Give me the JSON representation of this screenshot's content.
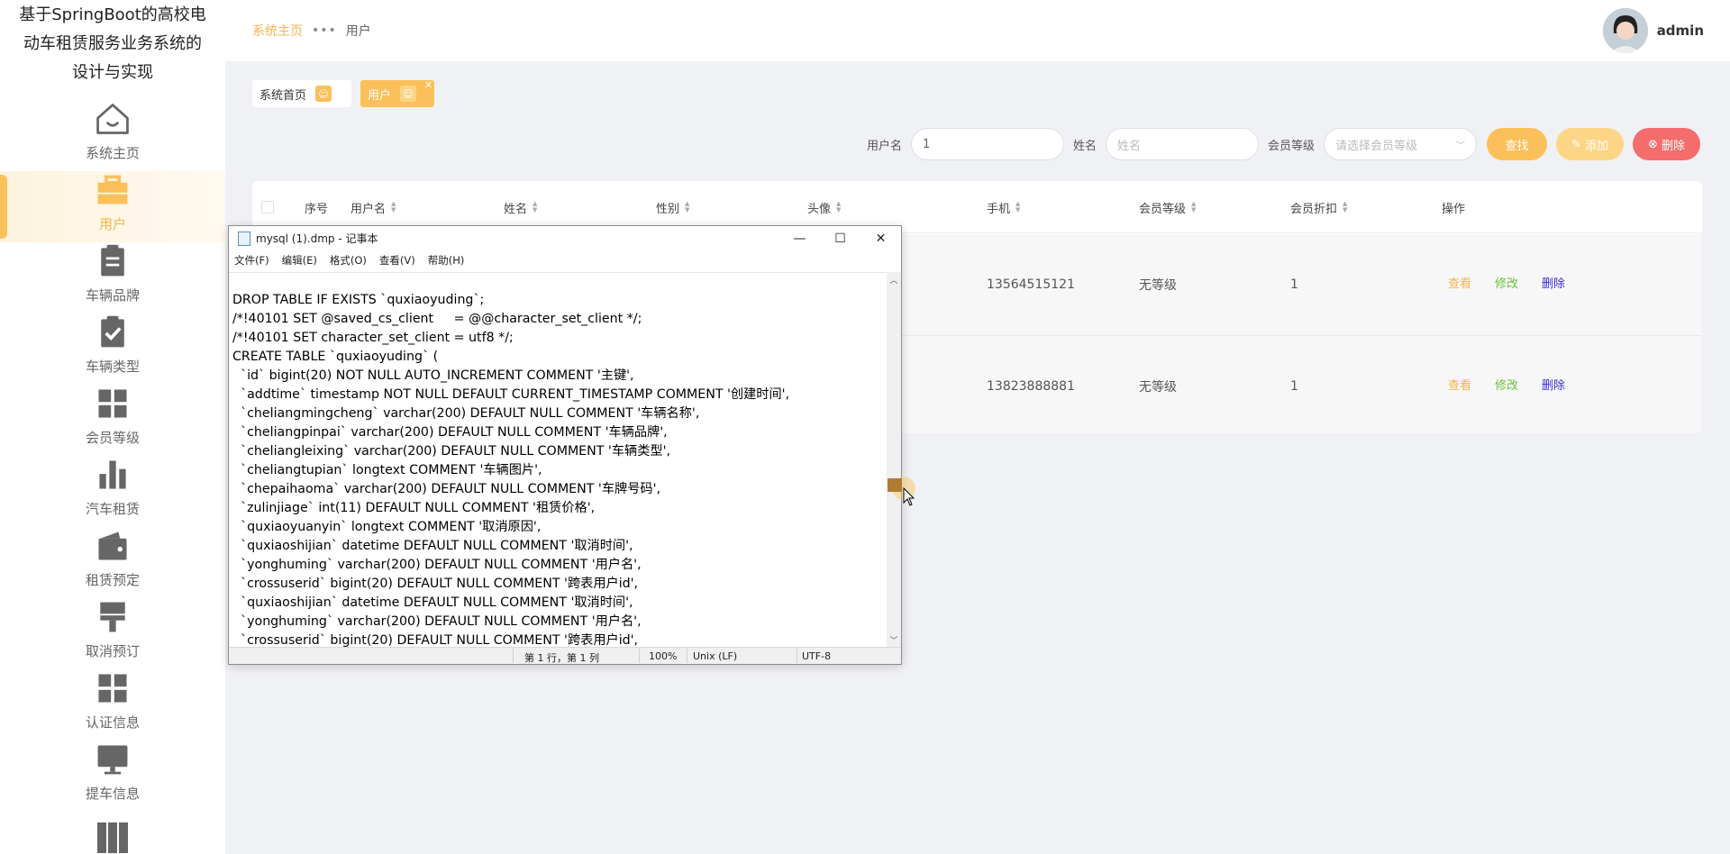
{
  "app": {
    "title_line1": "基于SpringBoot的高校电",
    "title_line2": "动车租赁服务业务系统的",
    "title_line3": "设计与实现"
  },
  "sidebar": {
    "items": [
      {
        "label": "系统主页",
        "icon": "home-icon"
      },
      {
        "label": "用户",
        "icon": "briefcase-icon",
        "active": true
      },
      {
        "label": "车辆品牌",
        "icon": "clipboard-icon"
      },
      {
        "label": "车辆类型",
        "icon": "checklist-icon"
      },
      {
        "label": "会员等级",
        "icon": "grid-icon"
      },
      {
        "label": "汽车租赁",
        "icon": "bar-chart-icon"
      },
      {
        "label": "租赁预定",
        "icon": "wallet-icon"
      },
      {
        "label": "取消预订",
        "icon": "brush-icon"
      },
      {
        "label": "认证信息",
        "icon": "grid-icon"
      },
      {
        "label": "提车信息",
        "icon": "monitor-icon"
      }
    ]
  },
  "header": {
    "breadcrumb_home": "系统主页",
    "breadcrumb_sep": "•••",
    "breadcrumb_current": "用户",
    "username": "admin"
  },
  "tags": {
    "home": "系统首页",
    "current": "用户"
  },
  "search": {
    "username_label": "用户名",
    "username_value": "1",
    "name_label": "姓名",
    "name_placeholder": "姓名",
    "level_label": "会员等级",
    "level_placeholder": "请选择会员等级",
    "find_button": "查找",
    "add_button": "添加",
    "delete_button": "删除"
  },
  "table": {
    "headers": [
      "序号",
      "用户名",
      "姓名",
      "性别",
      "头像",
      "手机",
      "会员等级",
      "会员折扣",
      "操作"
    ],
    "rows": [
      {
        "phone": "13564515121",
        "level": "无等级",
        "discount": "1"
      },
      {
        "phone": "13823888881",
        "level": "无等级",
        "discount": "1"
      }
    ],
    "actions": {
      "view": "查看",
      "edit": "修改",
      "delete": "删除"
    }
  },
  "notepad": {
    "title": "mysql (1).dmp - 记事本",
    "menu": [
      "文件(F)",
      "编辑(E)",
      "格式(O)",
      "查看(V)",
      "帮助(H)"
    ],
    "content": "DROP TABLE IF EXISTS `quxiaoyuding`;\n/*!40101 SET @saved_cs_client     = @@character_set_client */;\n/*!40101 SET character_set_client = utf8 */;\nCREATE TABLE `quxiaoyuding` (\n  `id` bigint(20) NOT NULL AUTO_INCREMENT COMMENT '主键',\n  `addtime` timestamp NOT NULL DEFAULT CURRENT_TIMESTAMP COMMENT '创建时间',\n  `cheliangmingcheng` varchar(200) DEFAULT NULL COMMENT '车辆名称',\n  `cheliangpinpai` varchar(200) DEFAULT NULL COMMENT '车辆品牌',\n  `cheliangleixing` varchar(200) DEFAULT NULL COMMENT '车辆类型',\n  `cheliangtupian` longtext COMMENT '车辆图片',\n  `chepaihaoma` varchar(200) DEFAULT NULL COMMENT '车牌号码',\n  `zulinjiage` int(11) DEFAULT NULL COMMENT '租赁价格',\n  `quxiaoyuanyin` longtext COMMENT '取消原因',\n  `quxiaoshijian` datetime DEFAULT NULL COMMENT '取消时间',\n  `yonghuming` varchar(200) DEFAULT NULL COMMENT '用户名',\n  `crossuserid` bigint(20) DEFAULT NULL COMMENT '跨表用户id',\n  `quxiaoshijian` datetime DEFAULT NULL COMMENT '取消时间',\n  `yonghuming` varchar(200) DEFAULT NULL COMMENT '用户名',\n  `crossuserid` bigint(20) DEFAULT NULL COMMENT '跨表用户id',",
    "status_pos": "第 1 行，第 1 列",
    "status_zoom": "100%",
    "status_eol": "Unix (LF)",
    "status_enc": "UTF-8"
  },
  "colors": {
    "accent": "#fcc05a",
    "danger": "#f56c6c",
    "success": "#67c23a"
  }
}
